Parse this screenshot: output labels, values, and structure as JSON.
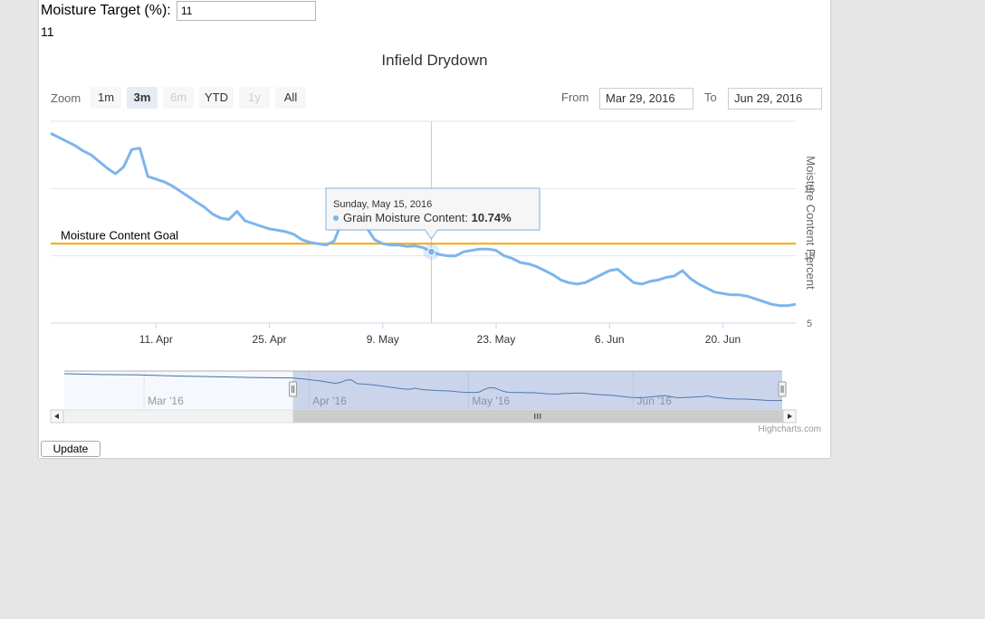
{
  "form": {
    "target_label": "Moisture Target (%):",
    "target_value": "11",
    "echo_value": "11",
    "update_label": "Update"
  },
  "range_selector": {
    "zoom_label": "Zoom",
    "buttons": [
      {
        "label": "1m",
        "state": "normal"
      },
      {
        "label": "3m",
        "state": "selected"
      },
      {
        "label": "6m",
        "state": "disabled"
      },
      {
        "label": "YTD",
        "state": "normal"
      },
      {
        "label": "1y",
        "state": "disabled"
      },
      {
        "label": "All",
        "state": "normal"
      }
    ],
    "from_label": "From",
    "from_value": "Mar 29, 2016",
    "to_label": "To",
    "to_value": "Jun 29, 2016"
  },
  "tooltip": {
    "date": "Sunday, May 15, 2016",
    "series_name": "Grain Moisture Content",
    "value_text": "10.74%"
  },
  "navigator": {
    "labels": [
      "Mar '16",
      "Apr '16",
      "May '16",
      "Jun '16"
    ]
  },
  "credit": "Highcharts.com",
  "colors": {
    "series": "#7cb5ec",
    "goal": "#f7a800",
    "navigator_series": "#4572a7",
    "selected_button": "#e6ebf5"
  },
  "chart_data": {
    "type": "line",
    "title": "Infield Drydown",
    "xlabel": "",
    "ylabel": "Moisture Content Percent",
    "x_range": [
      "2016-03-29",
      "2016-06-29"
    ],
    "ylim": [
      5,
      20
    ],
    "y_ticks": [
      5,
      10,
      15
    ],
    "x_tick_labels": [
      "11. Apr",
      "25. Apr",
      "9. May",
      "23. May",
      "6. Jun",
      "20. Jun"
    ],
    "x_tick_dates": [
      "2016-04-11",
      "2016-04-25",
      "2016-05-09",
      "2016-05-23",
      "2016-06-06",
      "2016-06-20"
    ],
    "grid": true,
    "plot_lines": [
      {
        "label": "Moisture Content Goal",
        "value": 10.9
      }
    ],
    "series": [
      {
        "name": "Grain Moisture Content",
        "x": [
          "2016-03-29",
          "2016-03-30",
          "2016-03-31",
          "2016-04-01",
          "2016-04-02",
          "2016-04-03",
          "2016-04-04",
          "2016-04-05",
          "2016-04-06",
          "2016-04-07",
          "2016-04-08",
          "2016-04-09",
          "2016-04-10",
          "2016-04-11",
          "2016-04-12",
          "2016-04-13",
          "2016-04-14",
          "2016-04-15",
          "2016-04-16",
          "2016-04-17",
          "2016-04-18",
          "2016-04-19",
          "2016-04-20",
          "2016-04-21",
          "2016-04-22",
          "2016-04-23",
          "2016-04-24",
          "2016-04-25",
          "2016-04-26",
          "2016-04-27",
          "2016-04-28",
          "2016-04-29",
          "2016-04-30",
          "2016-05-01",
          "2016-05-02",
          "2016-05-03",
          "2016-05-04",
          "2016-05-05",
          "2016-05-06",
          "2016-05-07",
          "2016-05-08",
          "2016-05-09",
          "2016-05-10",
          "2016-05-11",
          "2016-05-12",
          "2016-05-13",
          "2016-05-14",
          "2016-05-15",
          "2016-05-16",
          "2016-05-17",
          "2016-05-18",
          "2016-05-19",
          "2016-05-20",
          "2016-05-21",
          "2016-05-22",
          "2016-05-23",
          "2016-05-24",
          "2016-05-25",
          "2016-05-26",
          "2016-05-27",
          "2016-05-28",
          "2016-05-29",
          "2016-05-30",
          "2016-05-31",
          "2016-06-01",
          "2016-06-02",
          "2016-06-03",
          "2016-06-04",
          "2016-06-05",
          "2016-06-06",
          "2016-06-07",
          "2016-06-08",
          "2016-06-09",
          "2016-06-10",
          "2016-06-11",
          "2016-06-12",
          "2016-06-13",
          "2016-06-14",
          "2016-06-15",
          "2016-06-16",
          "2016-06-17",
          "2016-06-18",
          "2016-06-19",
          "2016-06-20",
          "2016-06-21",
          "2016-06-22",
          "2016-06-23",
          "2016-06-24",
          "2016-06-25",
          "2016-06-26",
          "2016-06-27",
          "2016-06-28",
          "2016-06-29"
        ],
        "y": [
          19.1,
          18.8,
          18.5,
          18.2,
          17.8,
          17.5,
          17.0,
          16.5,
          16.1,
          16.6,
          17.9,
          18.0,
          15.9,
          15.7,
          15.5,
          15.2,
          14.8,
          14.4,
          14.0,
          13.6,
          13.1,
          12.8,
          12.7,
          13.3,
          12.6,
          12.4,
          12.2,
          12.0,
          11.9,
          11.8,
          11.6,
          11.2,
          11.0,
          10.9,
          10.8,
          11.1,
          12.6,
          13.6,
          13.4,
          12.1,
          11.2,
          10.9,
          10.8,
          10.8,
          10.7,
          10.74,
          10.6,
          10.3,
          10.1,
          10.0,
          10.0,
          10.3,
          10.4,
          10.5,
          10.5,
          10.4,
          10.0,
          9.8,
          9.5,
          9.4,
          9.2,
          8.9,
          8.6,
          8.2,
          8.0,
          7.9,
          8.0,
          8.3,
          8.6,
          8.9,
          9.0,
          8.5,
          8.0,
          7.9,
          8.1,
          8.2,
          8.4,
          8.5,
          8.9,
          8.3,
          7.9,
          7.6,
          7.3,
          7.2,
          7.1,
          7.1,
          7.0,
          6.8,
          6.6,
          6.4,
          6.3,
          6.3,
          6.4
        ]
      }
    ]
  }
}
